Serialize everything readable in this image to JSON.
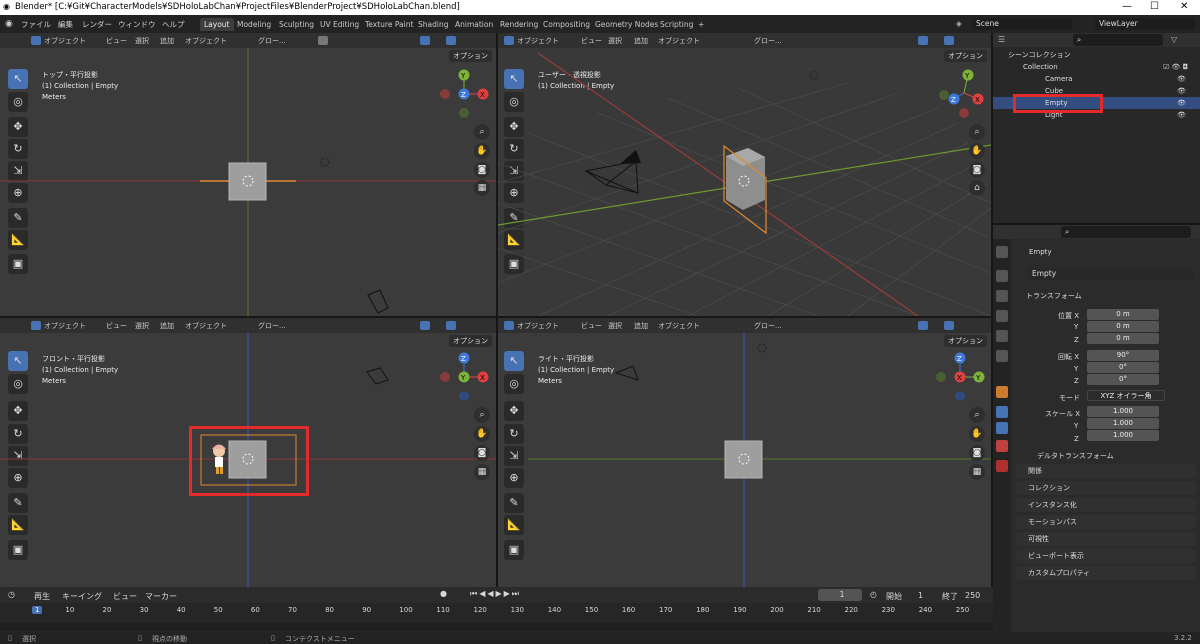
{
  "window": {
    "title": "Blender* [C:¥Git¥CharacterModels¥SDHoloLabChan¥ProjectFiles¥BlenderProject¥SDHoloLabChan.blend]",
    "minimize": "—",
    "maximize": "☐",
    "close": "✕"
  },
  "menu": [
    "ファイル",
    "編集",
    "レンダー",
    "ウィンドウ",
    "ヘルプ"
  ],
  "workspaces": [
    "Layout",
    "Modeling",
    "Sculpting",
    "UV Editing",
    "Texture Paint",
    "Shading",
    "Animation",
    "Rendering",
    "Compositing",
    "Geometry Nodes",
    "Scripting",
    "+"
  ],
  "scene": "Scene",
  "viewlayer": "ViewLayer",
  "viewport_header": {
    "mode": "オブジェクト",
    "view": "ビュー",
    "select": "選択",
    "add": "追加",
    "object": "オブジェクト",
    "orient": "グロー...",
    "options": "オプション"
  },
  "viewports": [
    {
      "name": "top",
      "title": "トップ・平行投影",
      "collection": "(1) Collection | Empty",
      "units": "Meters"
    },
    {
      "name": "user",
      "title": "ユーザー・透視投影",
      "collection": "(1) Collection | Empty",
      "units": ""
    },
    {
      "name": "front",
      "title": "フロント・平行投影",
      "collection": "(1) Collection | Empty",
      "units": "Meters"
    },
    {
      "name": "right",
      "title": "ライト・平行投影",
      "collection": "(1) Collection | Empty",
      "units": "Meters"
    }
  ],
  "gizmo": {
    "x": "X",
    "y": "Y",
    "z": "Z"
  },
  "outliner": {
    "root": "シーンコレクション",
    "collection": "Collection",
    "items": [
      "Camera",
      "Cube",
      "Empty",
      "Light"
    ],
    "selected": "Empty"
  },
  "properties": {
    "object_name": "Empty",
    "data_name": "Empty",
    "transform": "トランスフォーム",
    "location_label": "位置 X",
    "rotation_label": "回転 X",
    "scale_label": "スケール X",
    "y": "Y",
    "z": "Z",
    "location": [
      "0 m",
      "0 m",
      "0 m"
    ],
    "rotation": [
      "90°",
      "0°",
      "0°"
    ],
    "mode_label": "モード",
    "mode_value": "XYZ オイラー角",
    "scale": [
      "1.000",
      "1.000",
      "1.000"
    ],
    "delta": "デルタトランスフォーム",
    "panels": [
      "関係",
      "コレクション",
      "インスタンス化",
      "モーションパス",
      "可視性",
      "ビューポート表示",
      "カスタムプロパティ"
    ]
  },
  "timeline": {
    "menu": [
      "再生",
      "キーイング",
      "ビュー",
      "マーカー"
    ],
    "current": "1",
    "start_label": "開始",
    "start": "1",
    "end_label": "終了",
    "end": "250",
    "ruler": [
      "1",
      "10",
      "20",
      "30",
      "40",
      "50",
      "60",
      "70",
      "80",
      "90",
      "100",
      "110",
      "120",
      "130",
      "140",
      "150",
      "160",
      "170",
      "180",
      "190",
      "200",
      "210",
      "220",
      "230",
      "240",
      "250"
    ]
  },
  "status": {
    "select": "選択",
    "rotate": "視点の移動",
    "context": "コンテクストメニュー",
    "version": "3.2.2"
  },
  "colors": {
    "accent": "#4772b3",
    "highlight": "#e32b2b",
    "x_axis": "#b53a3a",
    "y_axis": "#6a9a2a",
    "z_axis": "#2d5ec9"
  }
}
